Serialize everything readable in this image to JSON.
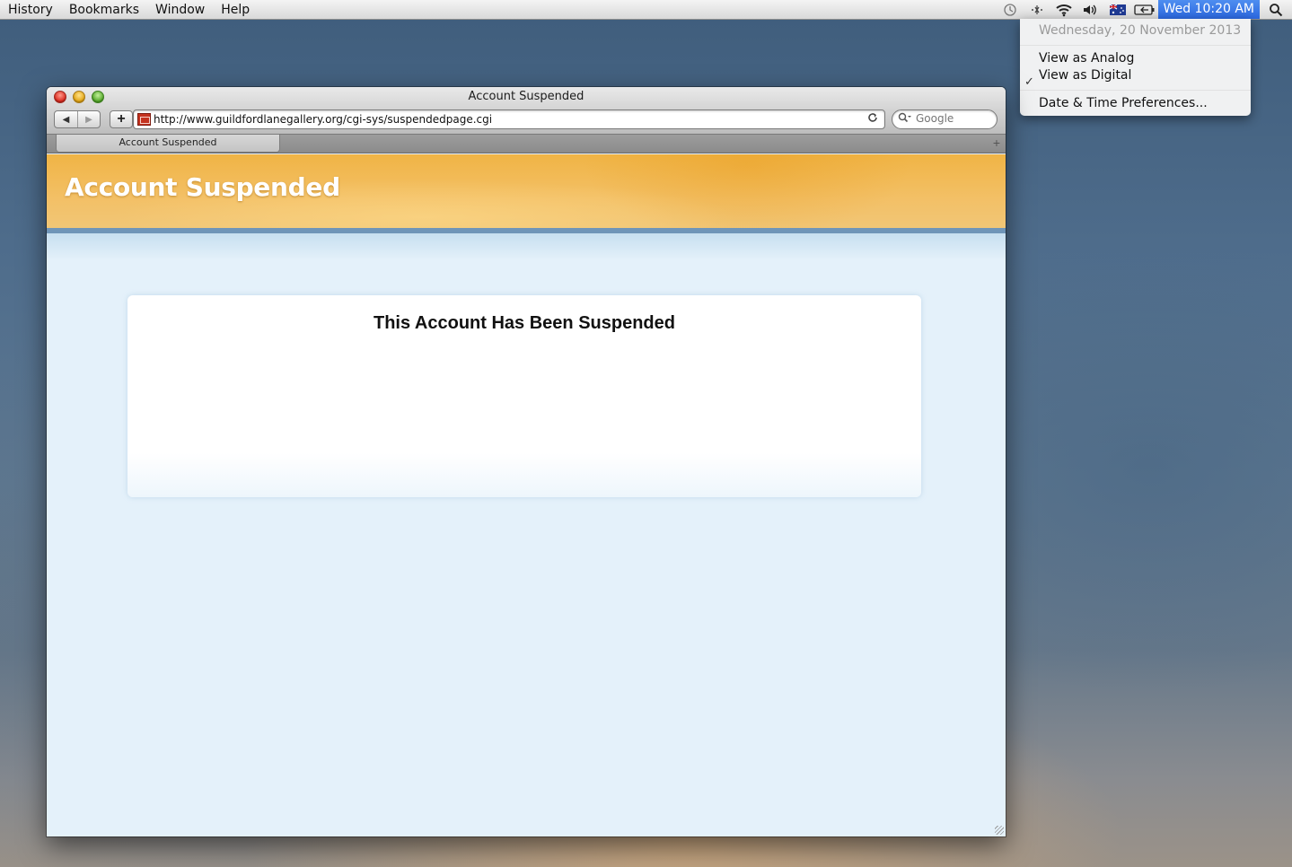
{
  "menubar": {
    "items": [
      "History",
      "Bookmarks",
      "Window",
      "Help"
    ],
    "clock": "Wed 10:20 AM",
    "status_icons": [
      "time-machine-icon",
      "bluetooth-icon",
      "wifi-icon",
      "volume-icon",
      "flag-australia-icon",
      "battery-icon"
    ]
  },
  "clock_menu": {
    "date": "Wednesday, 20 November 2013",
    "items": [
      "View as Analog",
      "View as Digital",
      "Date & Time Preferences..."
    ],
    "checked": "View as Digital",
    "check_mark": "✓"
  },
  "browser": {
    "window_title": "Account Suspended",
    "url": "http://www.guildfordlanegallery.org/cgi-sys/suspendedpage.cgi",
    "search_placeholder": "Google",
    "tabs": [
      "Account Suspended"
    ]
  },
  "page": {
    "banner_title": "Account Suspended",
    "heading": "This Account Has Been Suspended"
  },
  "colors": {
    "banner": "#f0b445",
    "page_bg": "#e4f1fa",
    "highlight": "#2b67df"
  }
}
